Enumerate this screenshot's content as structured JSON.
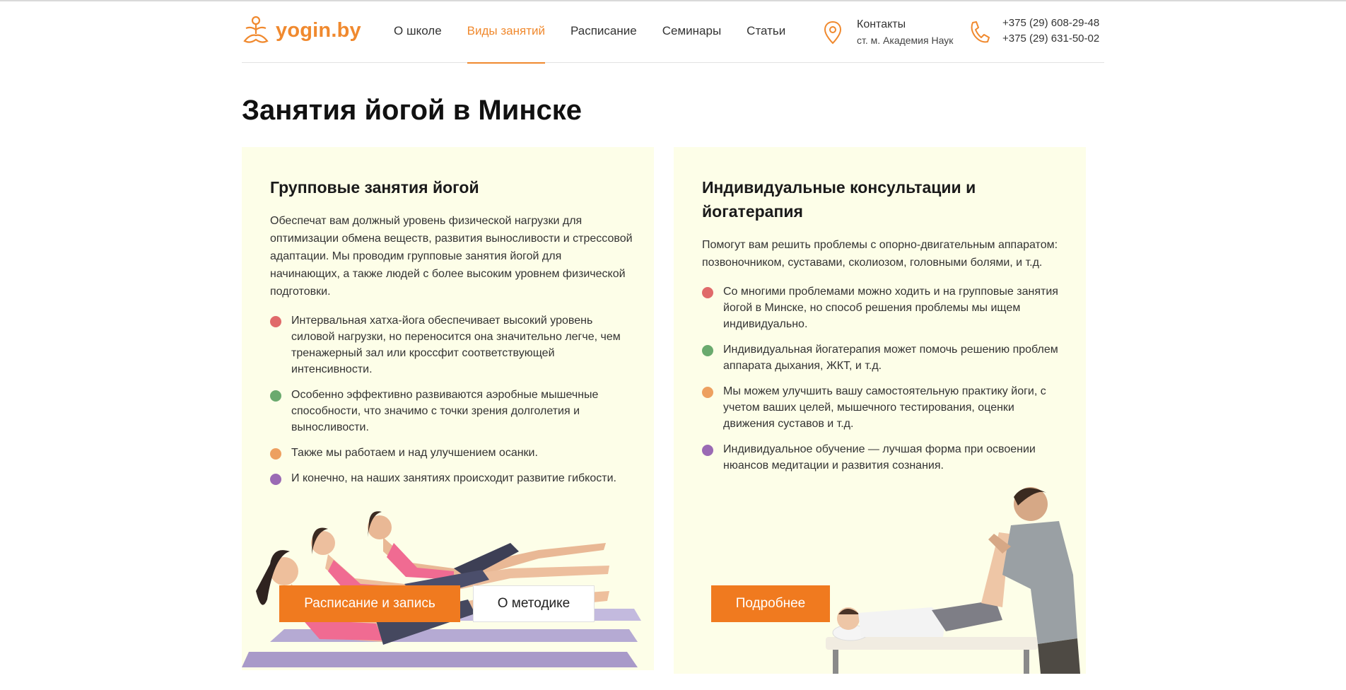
{
  "header": {
    "logo_text": "yogin.by",
    "nav": [
      {
        "label": "О школе",
        "active": false
      },
      {
        "label": "Виды занятий",
        "active": true
      },
      {
        "label": "Расписание",
        "active": false
      },
      {
        "label": "Семинары",
        "active": false
      },
      {
        "label": "Статьи",
        "active": false
      }
    ],
    "contacts": {
      "title": "Контакты",
      "subtitle": "ст. м. Академия Наук",
      "icon": "map-pin-icon"
    },
    "phones": {
      "icon": "phone-icon",
      "numbers": [
        "+375 (29) 608-29-48",
        "+375 (29) 631-50-02"
      ]
    }
  },
  "page": {
    "title": "Занятия йогой в Минске"
  },
  "cards": [
    {
      "title": "Групповые занятия йогой",
      "description": "Обеспечат вам должный уровень физической нагрузки для оптимизации обмена веществ, развития выносливости и стрессовой адаптации. Мы проводим групповые занятия йогой для начинающих, а также людей с более высоким уровнем физической подготовки.",
      "bullets": [
        {
          "text": "Интервальная хатха-йога обеспечивает высокий уровень силовой нагрузки, но переносится она значительно легче, чем тренажерный зал или кроссфит соответствующей интенсивности.",
          "color": "#e06a6a"
        },
        {
          "text": "Особенно эффективно развиваются аэробные мышечные способности, что значимо с точки зрения долголетия и выносливости.",
          "color": "#6aaa6e"
        },
        {
          "text": "Также мы работаем и над улучшением осанки.",
          "color": "#eda060"
        },
        {
          "text": "И конечно, на наших занятиях происходит развитие гибкости.",
          "color": "#9a6ab4"
        }
      ],
      "buttons": {
        "primary": "Расписание и запись",
        "secondary": "О методике"
      }
    },
    {
      "title": "Индивидуальные консультации и йогатерапия",
      "description": "Помогут вам решить проблемы с опорно-двигательным аппаратом: позвоночником, суставами, сколиозом, головными болями, и т.д.",
      "bullets": [
        {
          "text": "Со многими проблемами можно ходить и на групповые занятия йогой в Минске, но способ решения проблемы мы ищем индивидуально.",
          "color": "#e06a6a"
        },
        {
          "text": "Индивидуальная йогатерапия может помочь решению проблем аппарата дыхания, ЖКТ, и т.д.",
          "color": "#6aaa6e"
        },
        {
          "text": "Мы можем улучшить вашу самостоятельную практику йоги, с учетом ваших целей, мышечного тестирования, оценки движения суставов и т.д.",
          "color": "#eda060"
        },
        {
          "text": "Индивидуальное обучение — лучшая форма при освоении нюансов медитации и развития сознания.",
          "color": "#9a6ab4"
        }
      ],
      "buttons": {
        "primary": "Подробнее"
      }
    }
  ],
  "colors": {
    "accent": "#f0892e",
    "button": "#f07a1f",
    "card_bg": "#fdfee8"
  }
}
